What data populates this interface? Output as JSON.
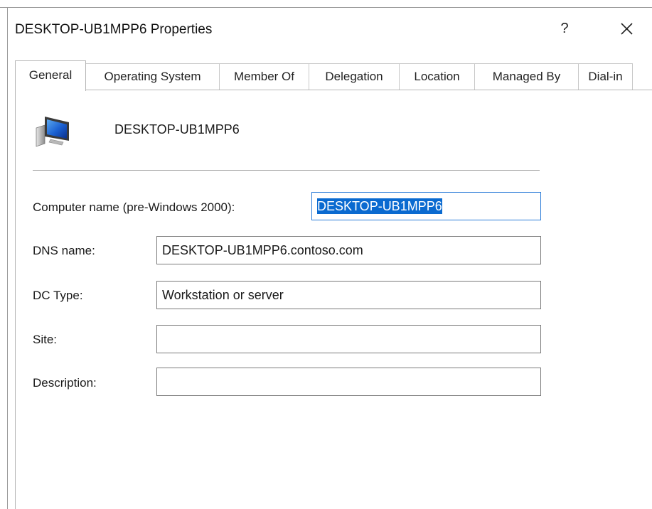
{
  "window": {
    "title": "DESKTOP-UB1MPP6 Properties",
    "help_label": "?",
    "close_icon": "close-icon"
  },
  "tabs": [
    {
      "label": "General",
      "active": true
    },
    {
      "label": "Operating System",
      "active": false
    },
    {
      "label": "Member Of",
      "active": false
    },
    {
      "label": "Delegation",
      "active": false
    },
    {
      "label": "Location",
      "active": false
    },
    {
      "label": "Managed By",
      "active": false
    },
    {
      "label": "Dial-in",
      "active": false
    }
  ],
  "general": {
    "icon": "computer-icon",
    "computer_display_name": "DESKTOP-UB1MPP6",
    "fields": {
      "pre_windows_2000_name": {
        "label": "Computer name (pre-Windows 2000):",
        "value": "DESKTOP-UB1MPP6"
      },
      "dns_name": {
        "label": "DNS name:",
        "value": "DESKTOP-UB1MPP6.contoso.com"
      },
      "dc_type": {
        "label": "DC Type:",
        "value": "Workstation or server"
      },
      "site": {
        "label": "Site:",
        "value": ""
      },
      "description": {
        "label": "Description:",
        "value": ""
      }
    }
  },
  "colors": {
    "selection": "#0a6ad0",
    "focus_border": "#2a7bd8",
    "border": "#7a7a7a"
  }
}
